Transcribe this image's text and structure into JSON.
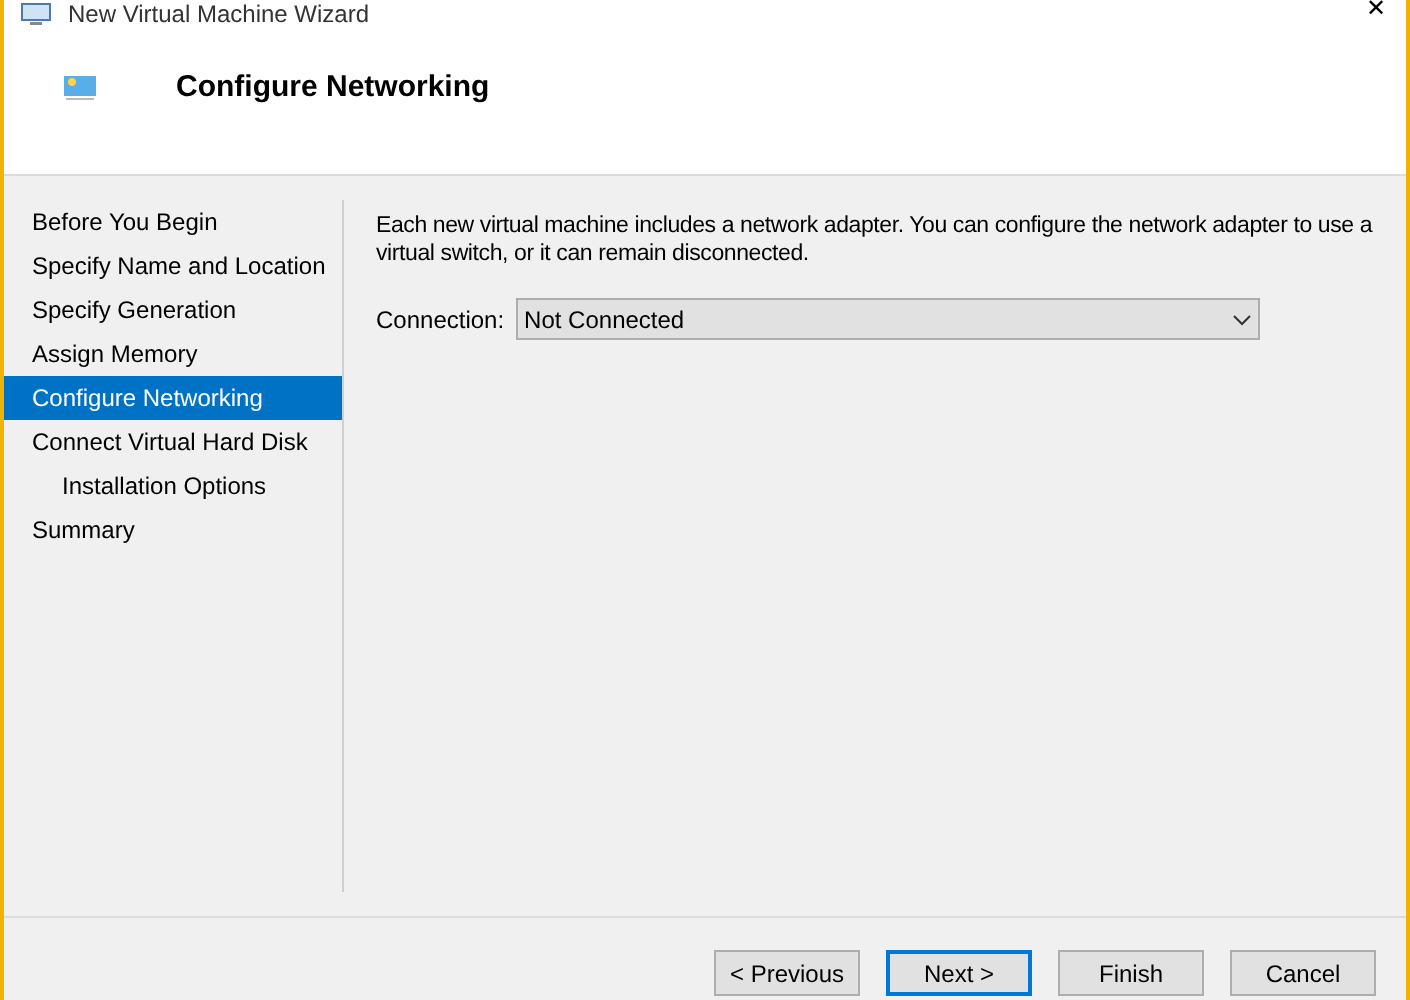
{
  "window": {
    "title": "New Virtual Machine Wizard",
    "close": "✕"
  },
  "header": {
    "title": "Configure Networking"
  },
  "steps": [
    {
      "label": "Before You Begin",
      "selected": false
    },
    {
      "label": "Specify Name and Location",
      "selected": false
    },
    {
      "label": "Specify Generation",
      "selected": false
    },
    {
      "label": "Assign Memory",
      "selected": false
    },
    {
      "label": "Configure Networking",
      "selected": true
    },
    {
      "label": "Connect Virtual Hard Disk",
      "selected": false,
      "children": [
        {
          "label": "Installation Options",
          "selected": false
        }
      ]
    },
    {
      "label": "Summary",
      "selected": false
    }
  ],
  "description": "Each new virtual machine includes a network adapter. You can configure the network adapter to use a virtual switch, or it can remain disconnected.",
  "connection": {
    "label": "Connection:",
    "value": "Not Connected"
  },
  "buttons": [
    {
      "label": "< Previous",
      "default": false
    },
    {
      "label": "Next >",
      "default": true
    },
    {
      "label": "Finish",
      "default": false
    },
    {
      "label": "Cancel",
      "default": false
    }
  ]
}
